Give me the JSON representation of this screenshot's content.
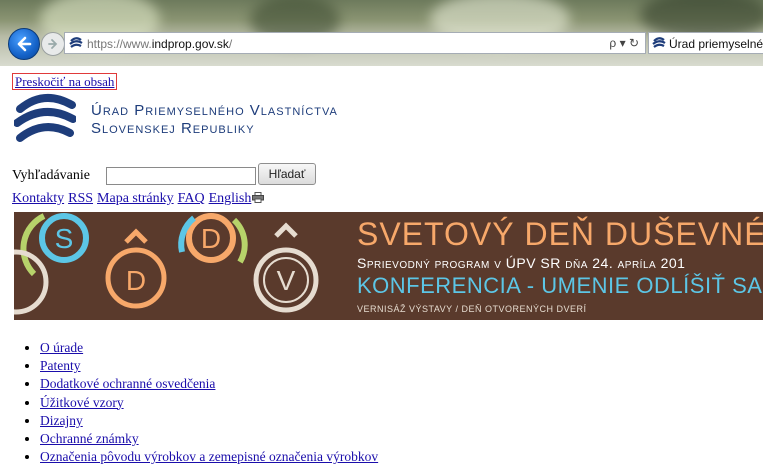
{
  "browser": {
    "url_prefix": "https://www.",
    "url_domain": "indprop.gov.sk",
    "url_suffix": "/",
    "search_control": "ρ ▾ ↻",
    "tab_title": "Úrad priemyselného"
  },
  "skip_link": "Preskočiť na obsah",
  "logo": {
    "line1": "Úrad Priemyselného Vlastníctva",
    "line2": "Slovenskej Republiky"
  },
  "search": {
    "label": "Vyhľadávanie",
    "value": "",
    "button": "Hľadať"
  },
  "links": [
    {
      "label": "Kontakty"
    },
    {
      "label": "RSS"
    },
    {
      "label": "Mapa stránky"
    },
    {
      "label": "FAQ"
    },
    {
      "label": "English"
    }
  ],
  "banner": {
    "letters": [
      "S",
      "D",
      "D",
      "V"
    ],
    "title": "SVETOVÝ DEŇ DUŠEVNÉHO V",
    "subtitle": "Sprievodný program v ÚPV SR dňa 24. apríla 201",
    "conference": "KONFERENCIA - UMENIE ODLÍŠIŤ SA",
    "footer": "VERNISÁŽ VÝSTAVY / DEŇ OTVORENÝCH DVERÍ"
  },
  "nav": [
    "O úrade",
    "Patenty",
    "Dodatkové ochranné osvedčenia",
    "Úžitkové vzory",
    "Dizajny",
    "Ochranné známky",
    "Označenia pôvodu výrobkov a zemepisné označenia výrobkov"
  ],
  "colors": {
    "link": "#1a0dab",
    "banner_bg": "#5a3a2c",
    "banner_orange": "#f7a86a",
    "banner_blue": "#5cc6e6",
    "logo_blue": "#1e3d7b"
  }
}
